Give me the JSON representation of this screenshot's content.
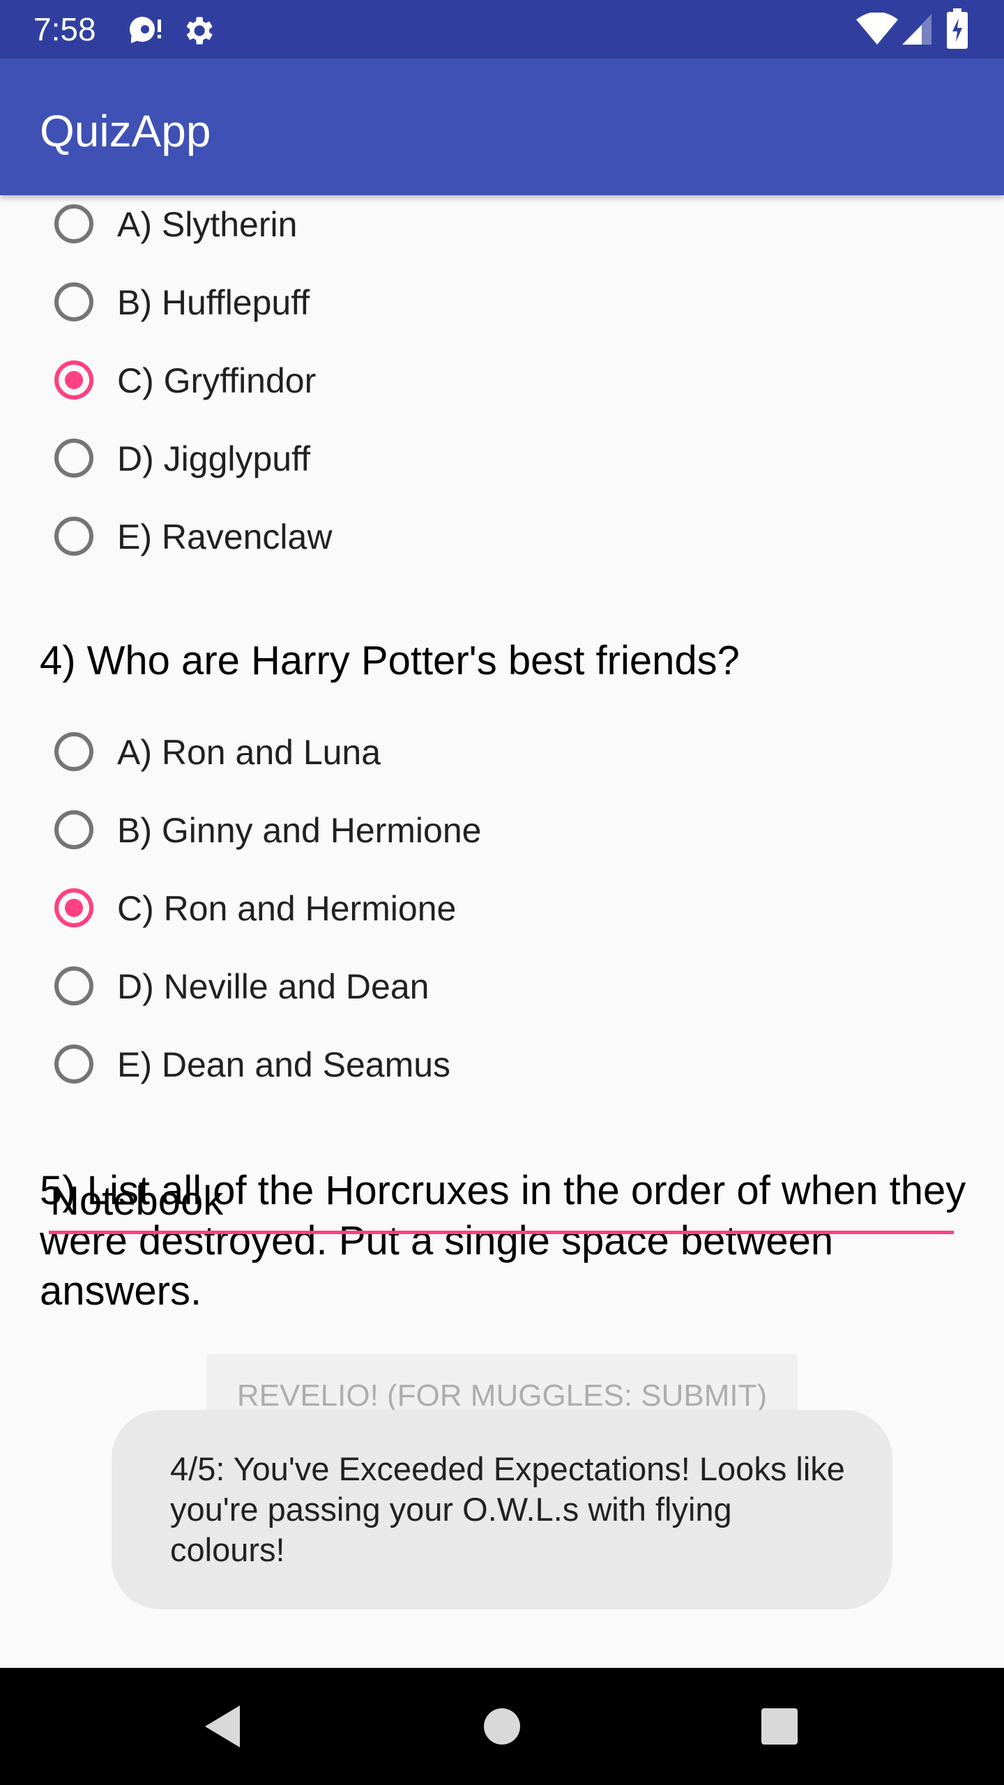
{
  "status_bar": {
    "time": "7:58",
    "icons": [
      "debug-icon",
      "settings-icon",
      "wifi-icon",
      "cell-signal-icon",
      "battery-icon"
    ]
  },
  "app_bar": {
    "title": "QuizApp"
  },
  "question3": {
    "options": [
      {
        "label": "A) Slytherin",
        "checked": false
      },
      {
        "label": "B) Hufflepuff",
        "checked": false
      },
      {
        "label": "C) Gryffindor",
        "checked": true
      },
      {
        "label": "D) Jigglypuff",
        "checked": false
      },
      {
        "label": "E) Ravenclaw",
        "checked": false
      }
    ]
  },
  "question4": {
    "text": "4) Who are Harry Potter's best friends?",
    "options": [
      {
        "label": "A) Ron and Luna",
        "checked": false
      },
      {
        "label": "B) Ginny and Hermione",
        "checked": false
      },
      {
        "label": "C) Ron and Hermione",
        "checked": true
      },
      {
        "label": "D) Neville and Dean",
        "checked": false
      },
      {
        "label": "E) Dean and Seamus",
        "checked": false
      }
    ]
  },
  "question5": {
    "text": "5) List all of the Horcruxes in the order of when they were destroyed. Put a single space between answers.",
    "answer_value": "Notebook"
  },
  "submit_button": {
    "label": "REVELIO! (FOR MUGGLES: SUBMIT)"
  },
  "toast": {
    "message": "4/5: You've Exceeded Expectations! Looks like you're passing your O.W.L.s with flying colours!"
  },
  "colors": {
    "primary": "#3f51b5",
    "primary_dark": "#303f9f",
    "accent": "#ff4081"
  },
  "nav_bar": {
    "icons": [
      "back-icon",
      "home-icon",
      "recents-icon"
    ]
  }
}
